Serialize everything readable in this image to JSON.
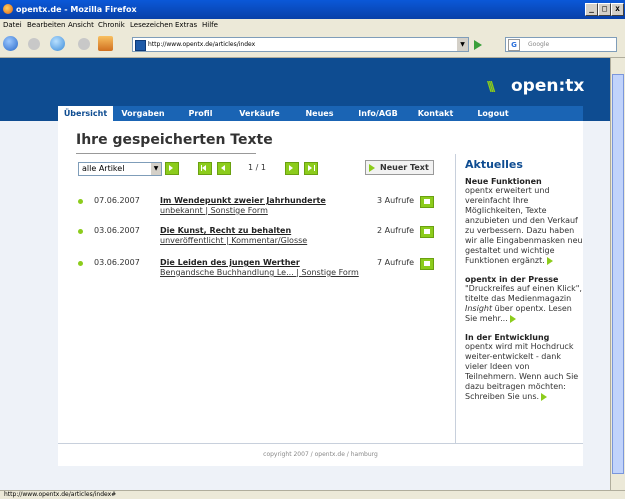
{
  "window": {
    "title": "opentx.de - Mozilla Firefox",
    "controls": [
      "_",
      "□",
      "x"
    ]
  },
  "menu": [
    "Datei",
    "Bearbeiten",
    "Ansicht",
    "Chronik",
    "Lesezeichen",
    "Extras",
    "Hilfe"
  ],
  "nav": {
    "url": "http://www.opentx.de/articles/index",
    "search_placeholder": "Google"
  },
  "site": {
    "logo": "open:tx",
    "tabs": [
      "Übersicht",
      "Vorgaben",
      "Profil",
      "Verkäufe",
      "Neues",
      "Info/AGB",
      "Kontakt",
      "Logout"
    ],
    "active_tab": "Übersicht"
  },
  "main": {
    "heading": "Ihre gespeicherten Texte",
    "filter_value": "alle Artikel",
    "page_indicator": "1 / 1",
    "new_button": "Neuer Text",
    "articles": [
      {
        "date": "07.06.2007",
        "title": "Im Wendepunkt zweier Jahrhunderte",
        "subtitle": "unbekannt | Sonstige Form",
        "views": "3 Aufrufe"
      },
      {
        "date": "03.06.2007",
        "title": "Die Kunst, Recht zu behalten",
        "subtitle": "unveröffentlicht | Kommentar/Glosse",
        "views": "2 Aufrufe"
      },
      {
        "date": "03.06.2007",
        "title": "Die Leiden des jungen Werther",
        "subtitle": "Bengandsche Buchhandlung Le... | Sonstige Form",
        "views": "7 Aufrufe"
      }
    ]
  },
  "sidebar": {
    "title": "Aktuelles",
    "news": [
      {
        "heading": "Neue Funktionen",
        "text": "opentx erweitert und vereinfacht Ihre Möglichkeiten, Texte anzubieten und den Verkauf zu verbessern. Dazu haben wir alle Eingabenmasken neu gestaltet und wichtige Funktionen ergänzt."
      },
      {
        "heading": "opentx in der Presse",
        "text_pre": "\"Druckreifes auf einen Klick\", titelte das Medienmagazin ",
        "text_em": "Insight",
        "text_post": " über opentx. Lesen Sie mehr..."
      },
      {
        "heading": "In der Entwicklung",
        "text": "opentx wird mit Hochdruck weiter-entwickelt - dank vieler Ideen von Teilnehmern. Wenn auch Sie dazu beitragen möchten: Schreiben Sie uns."
      }
    ]
  },
  "footer": "copyright 2007 / opentx.de / hamburg",
  "status": "http://www.opentx.de/articles/index#"
}
